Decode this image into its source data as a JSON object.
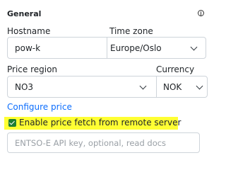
{
  "section": {
    "title": "General",
    "info_icon": "info-circle-icon"
  },
  "hostname": {
    "label": "Hostname",
    "value": "pow-k"
  },
  "timezone": {
    "label": "Time zone",
    "value": "Europe/Oslo"
  },
  "price_region": {
    "label": "Price region",
    "value": "NO3"
  },
  "currency": {
    "label": "Currency",
    "value": "NOK"
  },
  "configure_price": {
    "label": "Configure price"
  },
  "remote_fetch": {
    "label": "Enable price fetch from remote server",
    "checked": true,
    "highlight_color": "#ffff33",
    "checkbox_color": "#1e7e34"
  },
  "api_key": {
    "value": "",
    "placeholder": "ENTSO-E API key, optional, read docs"
  }
}
